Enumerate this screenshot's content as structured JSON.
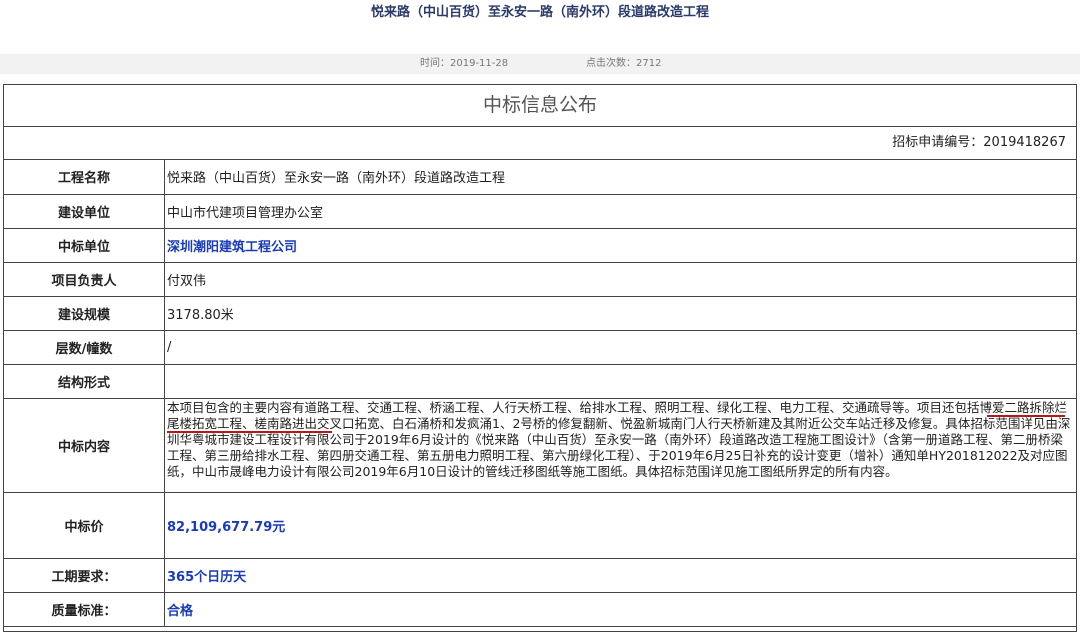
{
  "title": "悦来路（中山百货）至永安一路（南外环）段道路改造工程",
  "meta": {
    "time": "时间：2019-11-28",
    "hits": "点击次数：2712"
  },
  "notice_heading": "中标信息公布",
  "bid_number": "招标申请编号：2019418267",
  "rows": [
    {
      "label": "工程名称",
      "value": "悦来路（中山百货）至永安一路（南外环）段道路改造工程"
    },
    {
      "label": "建设单位",
      "value": "中山市代建项目管理办公室"
    },
    {
      "label": "中标单位",
      "value": "深圳潮阳建筑工程公司"
    },
    {
      "label": "项目负责人",
      "value": "付双伟"
    },
    {
      "label": "建设规模",
      "value": "3178.80米"
    },
    {
      "label": "层数/幢数",
      "value": "/"
    },
    {
      "label": "结构形式",
      "value": ""
    },
    {
      "label": "中标内容",
      "value": "本项目包含的主要内容有道路工程、交通工程、桥涵工程、人行天桥工程、给排水工程、照明工程、绿化工程、电力工程、交通疏导等。项目还包括博爱二路拆除烂尾楼拓宽工程、槎南路进出交叉口拓宽、白石涌桥和发疯涌1、2号桥的修复翻新、悦盈新城南门人行天桥新建及其附近公交车站迁移及修复。具体招标范围详见由深圳华粤城市建设工程设计有限公司于2019年6月设计的《悦来路（中山百货）至永安一路（南外环）段道路改造工程施工图设计》（含第一册道路工程、第二册桥梁工程、第三册给排水工程、第四册交通工程、第五册电力照明工程、第六册绿化工程）、于2019年6月25日补充的设计变更（增补）通知单HY201812022及对应图纸，中山市晟峰电力设计有限公司2019年6月10日设计的管线迁移图纸等施工图纸。具体招标范围详见施工图纸所界定的所有内容。"
    },
    {
      "label": "中标价",
      "value": "82,109,677.79元"
    },
    {
      "label": "工期要求：",
      "value": "365个日历天"
    },
    {
      "label": "质量标准：",
      "value": "合格"
    }
  ],
  "colors": {
    "frame": "#444444",
    "title": "#2a3a6a",
    "value_highlight": "#1a3bb8",
    "annotation": "#b01a1a"
  }
}
